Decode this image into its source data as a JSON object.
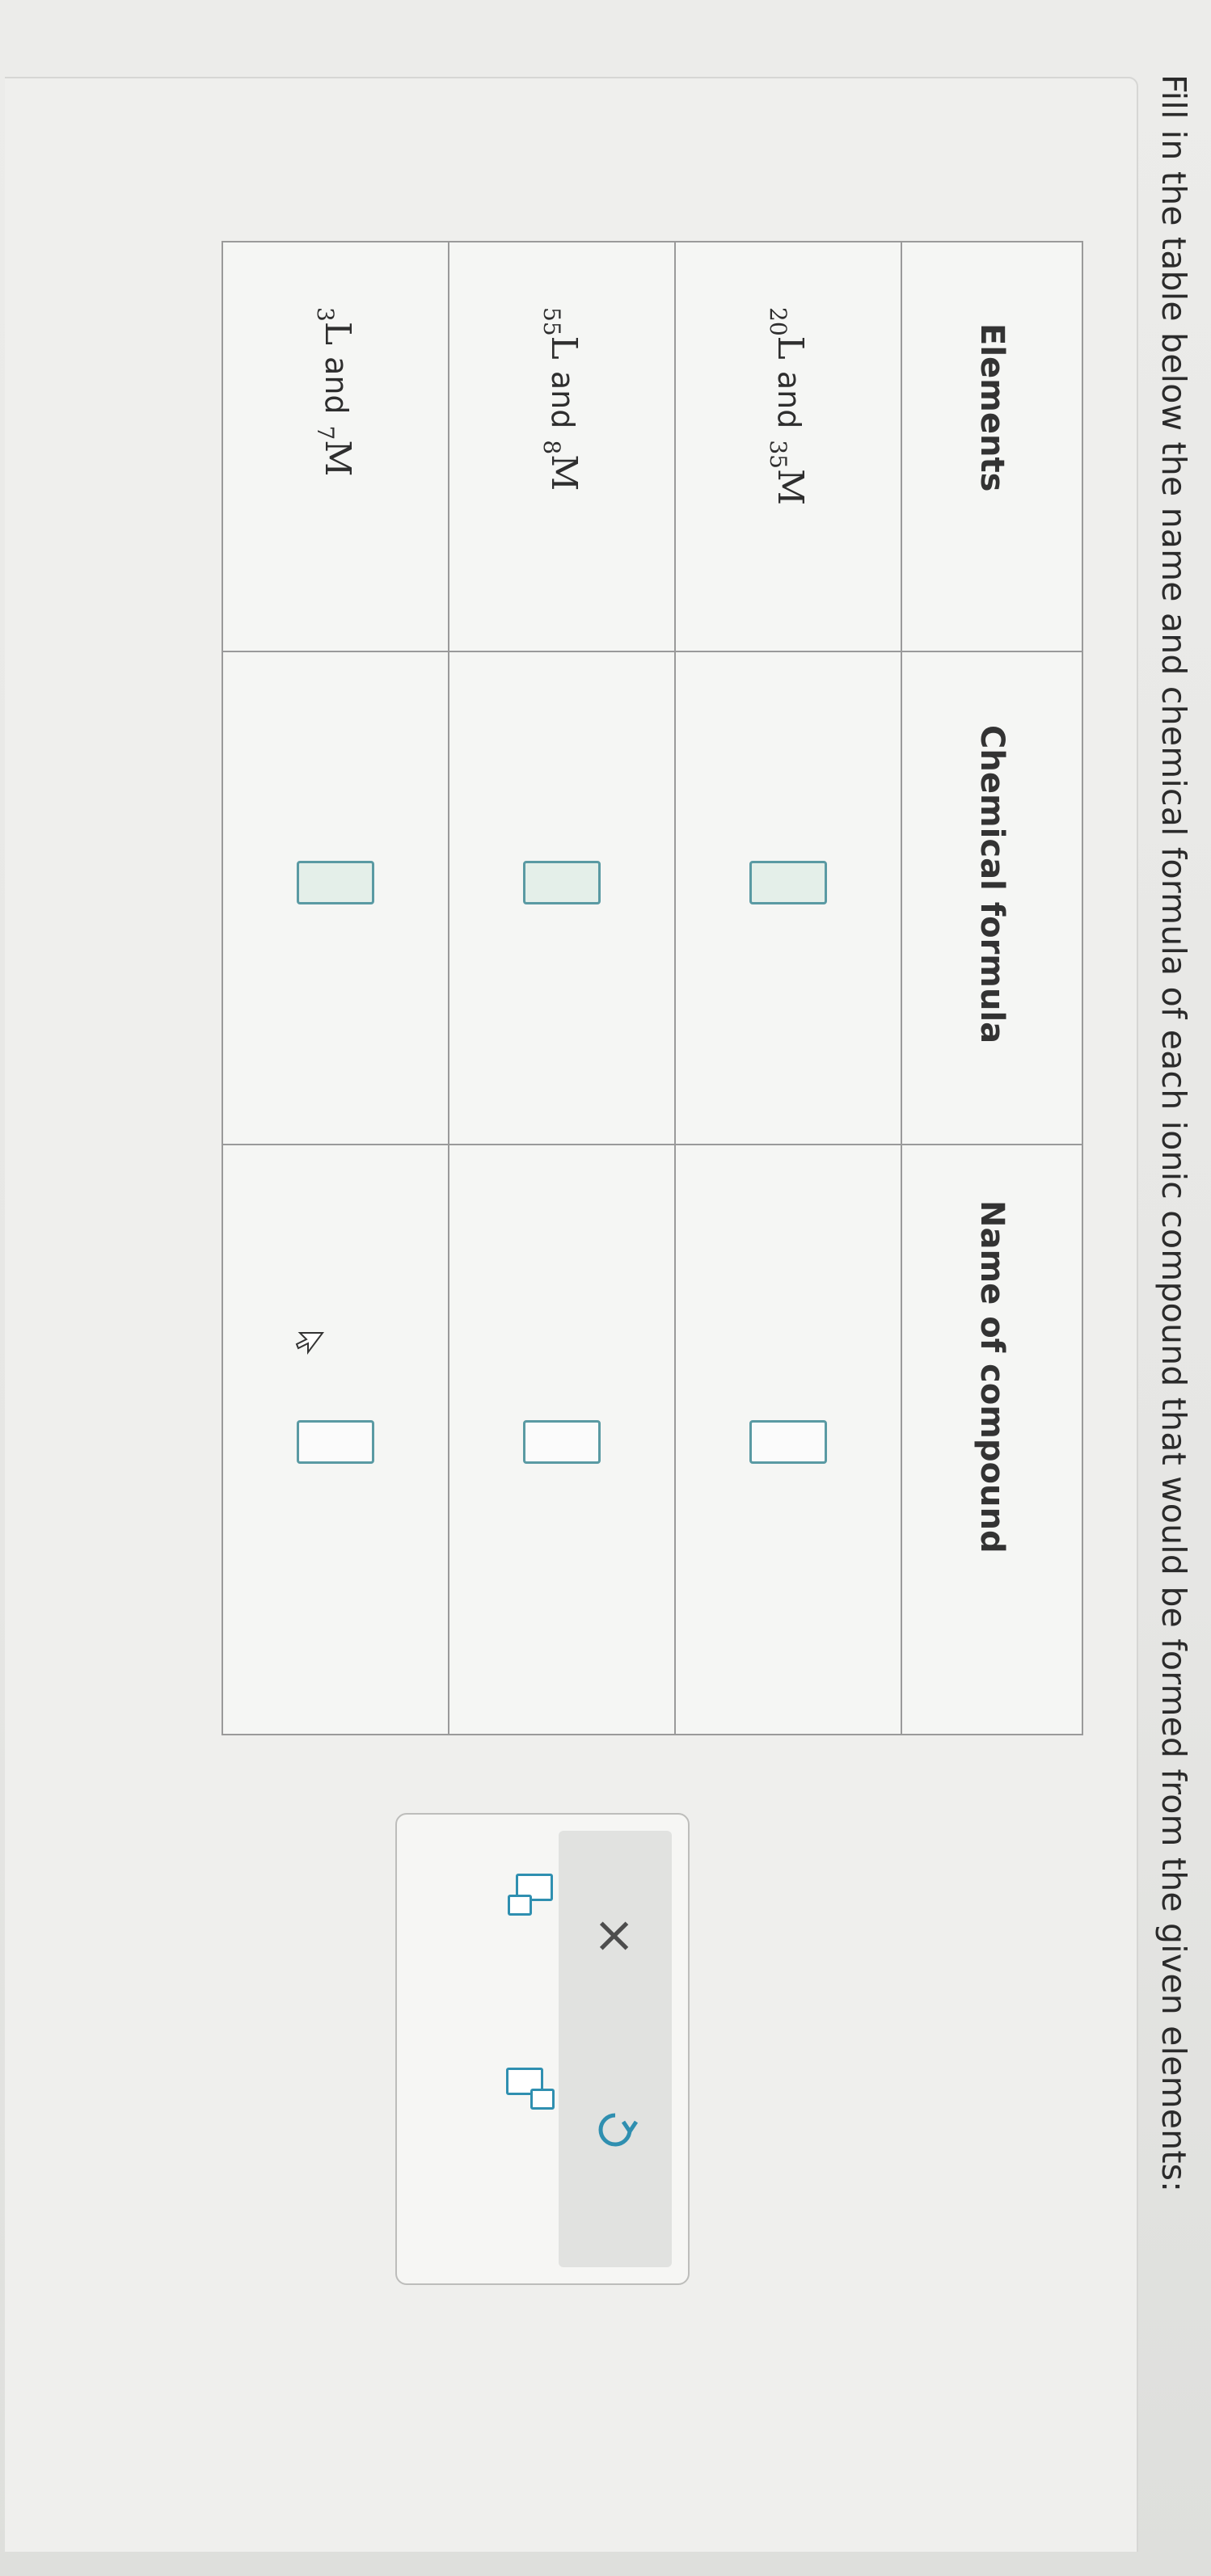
{
  "instructions": "Fill in the table below the name and chemical formula of each ionic compound that would be formed from the given elements:",
  "table": {
    "headers": [
      "Elements",
      "Chemical formula",
      "Name of compound"
    ],
    "rows": [
      {
        "l_num": "20",
        "m_num": "35",
        "l": "L",
        "m": "M",
        "and": "and",
        "formula": "",
        "name": ""
      },
      {
        "l_num": "55",
        "m_num": "8",
        "l": "L",
        "m": "M",
        "and": "and",
        "formula": "",
        "name": ""
      },
      {
        "l_num": "3",
        "m_num": "7",
        "l": "L",
        "m": "M",
        "and": "and",
        "formula": "",
        "name": ""
      }
    ]
  },
  "toolbar": {
    "clear_symbol": "×",
    "buttons": [
      "subscript-button",
      "superscript-button",
      "clear-button",
      "undo-button"
    ]
  },
  "colors": {
    "box_border": "#5a9aa3",
    "box_fill": "#e4efe9",
    "toolbar_icon": "#2f8fb0"
  }
}
